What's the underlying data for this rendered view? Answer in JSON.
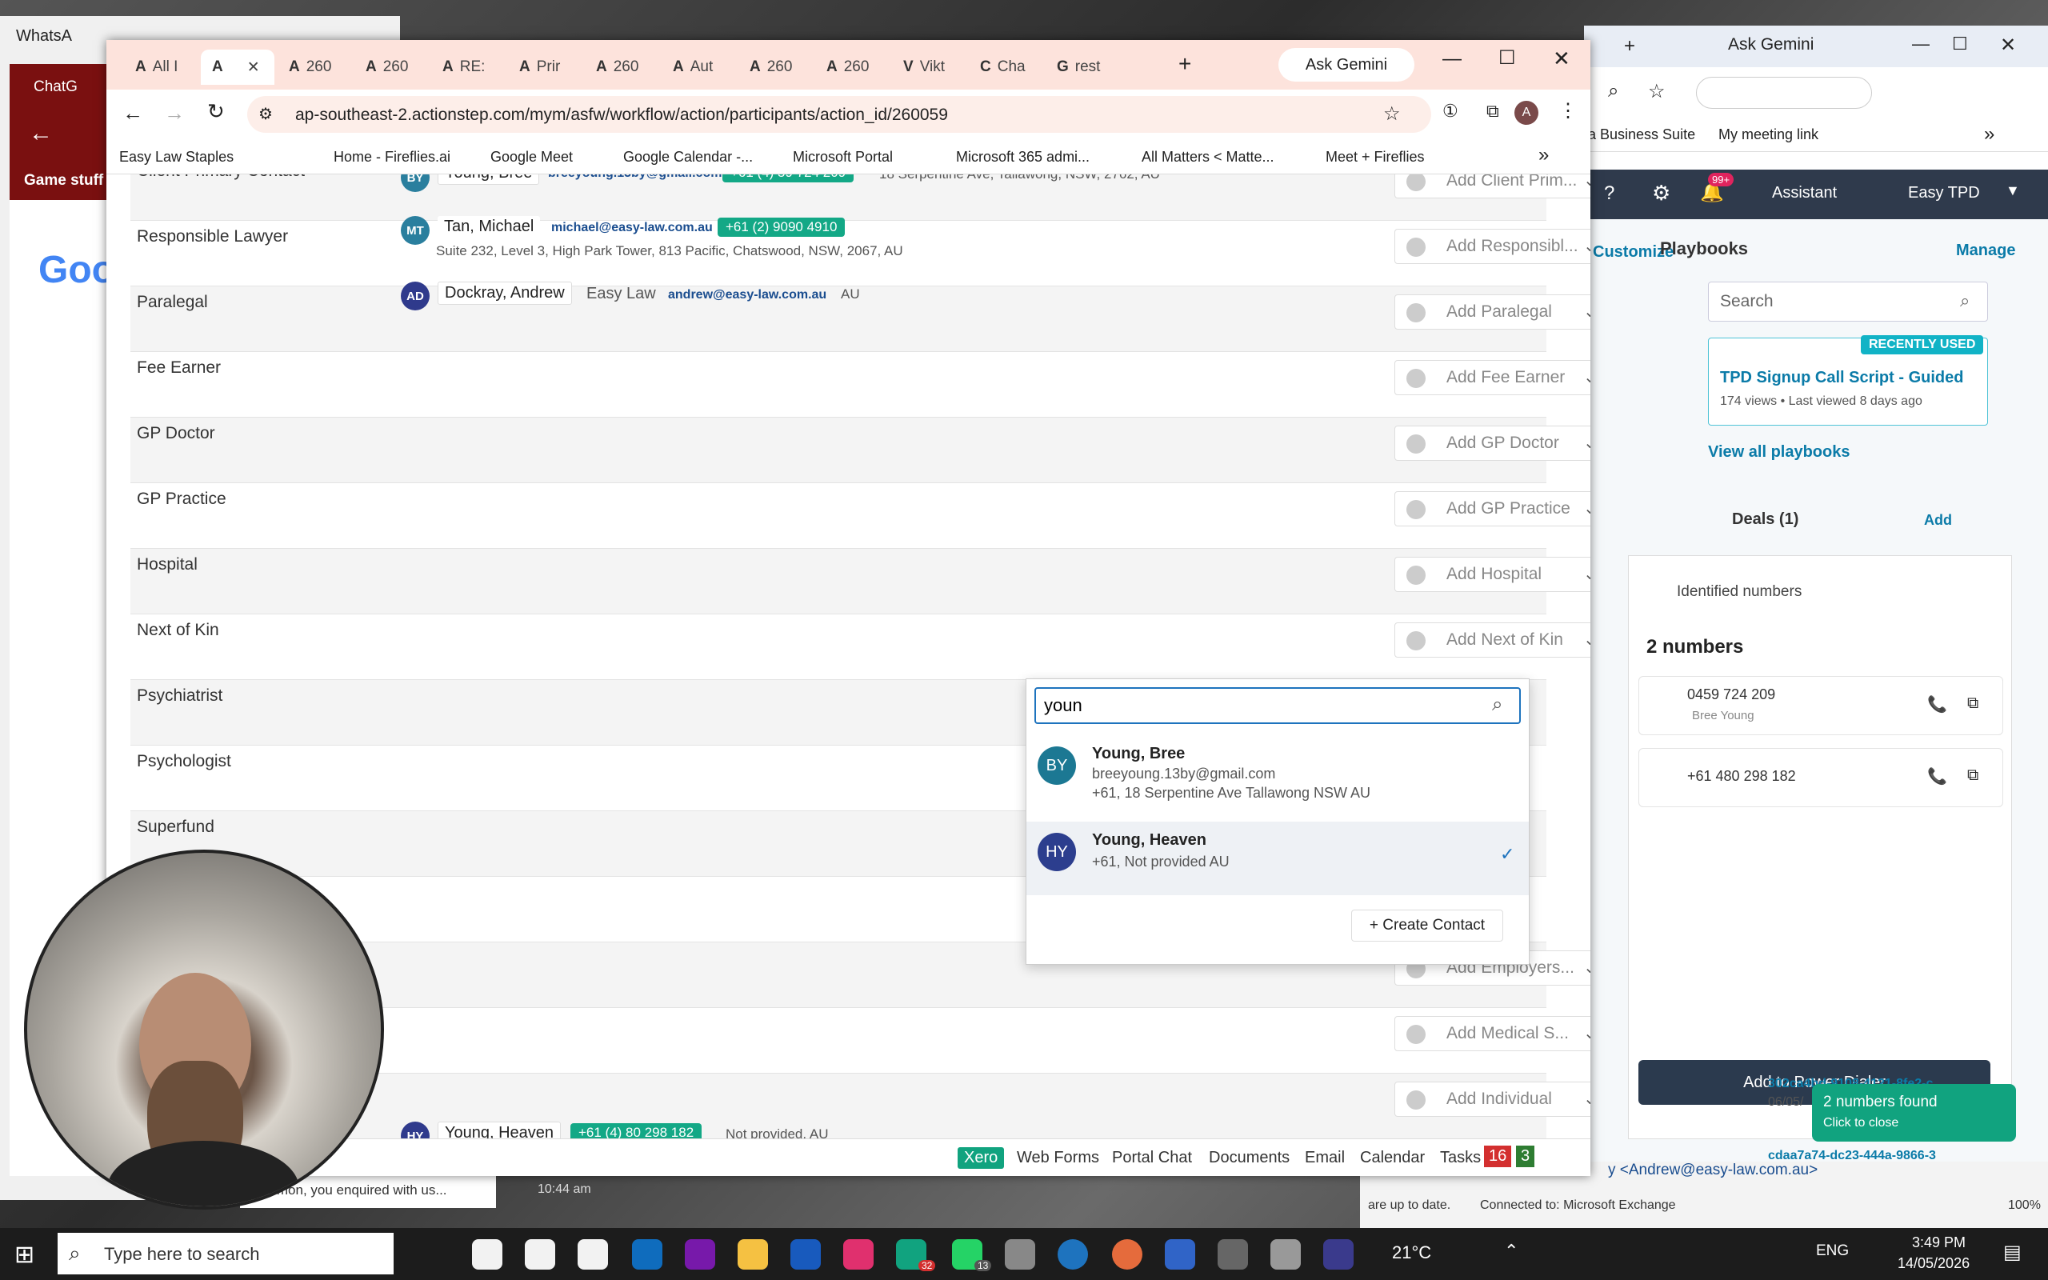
{
  "background": {
    "whatsapp_title": "WhatsA",
    "chatg_tab": "ChatG",
    "game_stuff": "Game stuff",
    "google_partial": "Goo",
    "outlook_email": "y <Andrew@easy-law.com.au>",
    "outlook_status1": "are up to date.",
    "outlook_status2": "Connected to: Microsoft Exchange",
    "outlook_zoom": "100%",
    "whatsapp_preview": "Hi Simon, you enquired with us...",
    "whatsapp_time": "10:44 am"
  },
  "browser_main": {
    "tabs": [
      {
        "icon": "A",
        "label": "All I"
      },
      {
        "icon": "A",
        "label": ""
      },
      {
        "icon": "A",
        "label": "260"
      },
      {
        "icon": "A",
        "label": "260"
      },
      {
        "icon": "A",
        "label": "RE:"
      },
      {
        "icon": "A",
        "label": "Prir"
      },
      {
        "icon": "A",
        "label": "260"
      },
      {
        "icon": "A",
        "label": "Aut"
      },
      {
        "icon": "A",
        "label": "260"
      },
      {
        "icon": "A",
        "label": "260"
      },
      {
        "icon": "V",
        "label": "Vikt"
      },
      {
        "icon": "C",
        "label": "Cha"
      },
      {
        "icon": "G",
        "label": "rest"
      }
    ],
    "new_tab": "+",
    "ask_gemini": "Ask Gemini",
    "url": "ap-southeast-2.actionstep.com/mym/asfw/workflow/action/participants/action_id/260059",
    "bookmarks": [
      "Easy Law Staples",
      "Home - Fireflies.ai",
      "Google Meet",
      "Google Calendar -...",
      "Microsoft Portal",
      "Microsoft 365 admi...",
      "All Matters < Matte...",
      "Meet + Fireflies"
    ],
    "more_bookmarks": "»",
    "profile_letter": "A"
  },
  "participants": {
    "rows": [
      {
        "label": "Client Primary Contact",
        "add": "Add Client Prim..."
      },
      {
        "label": "Responsible Lawyer",
        "add": "Add Responsibl..."
      },
      {
        "label": "Paralegal",
        "add": "Add Paralegal"
      },
      {
        "label": "Fee Earner",
        "add": "Add Fee Earner"
      },
      {
        "label": "GP Doctor",
        "add": "Add GP Doctor"
      },
      {
        "label": "GP Practice",
        "add": "Add GP Practice"
      },
      {
        "label": "Hospital",
        "add": "Add Hospital"
      },
      {
        "label": "Next of Kin",
        "add": "Add Next of Kin"
      },
      {
        "label": "Psychiatrist",
        "add": ""
      },
      {
        "label": "Psychologist",
        "add": ""
      },
      {
        "label": "Superfund",
        "add": ""
      },
      {
        "label": "",
        "add": ""
      },
      {
        "label": "",
        "add": "Add Employers..."
      },
      {
        "label": "",
        "add": "Add Medical S..."
      },
      {
        "label": "",
        "add": "Add Individual"
      }
    ],
    "client": {
      "initials": "BY",
      "name": "Young, Bree",
      "email": "breeyoung.13by@gmail.com",
      "phone": "+61 (4) 59 724 209",
      "address": "18 Serpentine Ave, Tallawong, NSW, 2762, AU"
    },
    "lawyer": {
      "initials": "MT",
      "name": "Tan, Michael",
      "email": "michael@easy-law.com.au",
      "phone": "+61 (2) 9090 4910",
      "address": "Suite 232, Level 3, High Park Tower, 813 Pacific, Chatswood, NSW, 2067, AU"
    },
    "paralegal": {
      "initials": "AD",
      "name": "Dockray, Andrew",
      "org": "Easy Law",
      "email": "andrew@easy-law.com.au",
      "country": "AU"
    },
    "individual": {
      "initials": "HY",
      "name": "Young, Heaven",
      "phone": "+61 (4) 80 298 182",
      "address": "Not provided, AU"
    }
  },
  "dropdown": {
    "query": "youn",
    "results": [
      {
        "initials": "BY",
        "name": "Young, Bree",
        "line2": "breeyoung.13by@gmail.com",
        "line3": "+61, 18 Serpentine Ave Tallawong NSW AU"
      },
      {
        "initials": "HY",
        "name": "Young, Heaven",
        "line2": "+61, Not provided AU",
        "line3": ""
      }
    ],
    "create_contact": "Create Contact"
  },
  "bottom_bar": {
    "items": [
      "Xero",
      "Web Forms",
      "Portal Chat",
      "Documents",
      "Email",
      "Calendar",
      "Tasks"
    ],
    "tasks_red": "16",
    "tasks_green": "3"
  },
  "right_browser": {
    "ask_gemini": "Ask Gemini",
    "bookmark1": "ta Business Suite",
    "bookmark2": "My meeting link",
    "assistant": "Assistant",
    "account": "Easy TPD",
    "badge": "99+",
    "customize": "Customize",
    "playbooks": "Playbooks",
    "manage": "Manage",
    "search_placeholder": "Search",
    "recently_used": "RECENTLY USED",
    "playbook_title": "TPD Signup Call Script - Guided",
    "playbook_meta": "174 views • Last viewed 8 days ago",
    "view_all": "View all playbooks",
    "deals": "Deals (1)",
    "add": "Add",
    "identified": "Identified numbers",
    "count": "2 numbers",
    "numbers": [
      {
        "number": "0459 724 209",
        "contact": "Bree Young"
      },
      {
        "number": "+61 480 298 182",
        "contact": ""
      }
    ],
    "power_dialer": "Add to Power Dialer",
    "file1": "302ca4bd-9108-4121-8fe2-c",
    "file1_date": "06/05/",
    "file2": "cdaa7a74-dc23-444a-9866-3",
    "toast_title": "2 numbers found",
    "toast_sub": "Click to close"
  },
  "taskbar": {
    "search_placeholder": "Type here to search",
    "badge_green": "32",
    "badge_whatsapp": "13",
    "weather": "21°C",
    "lang": "ENG",
    "time": "3:49 PM",
    "date": "14/05/2026"
  }
}
